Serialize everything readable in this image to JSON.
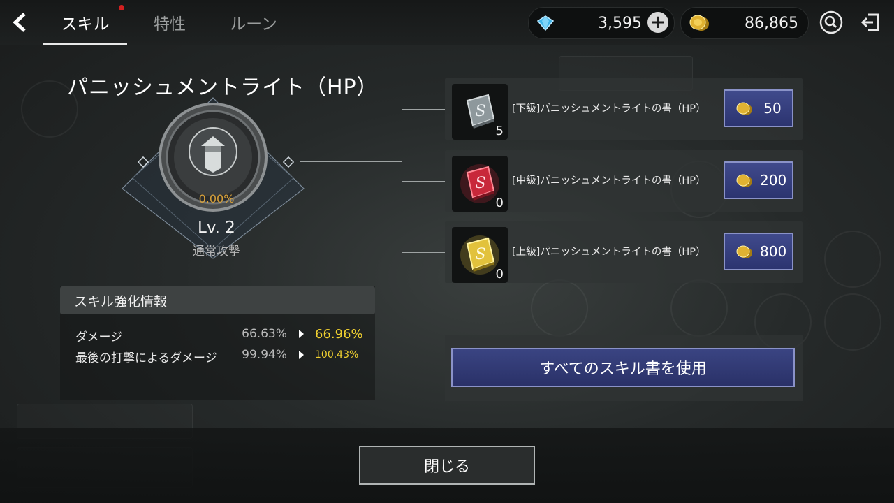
{
  "topbar": {
    "tabs": [
      {
        "label": "スキル",
        "active": true,
        "notify": true
      },
      {
        "label": "特性",
        "active": false,
        "notify": false
      },
      {
        "label": "ルーン",
        "active": false,
        "notify": false
      }
    ],
    "gems": "3,595",
    "gold": "86,865",
    "icons": {
      "back": "back-arrow-icon",
      "search": "search-icon",
      "exit": "exit-icon",
      "gem": "gem-icon",
      "gold": "gold-coin-icon",
      "plus": "plus-icon"
    }
  },
  "skill": {
    "title": "パニッシュメントライト（HP）",
    "progress_text": "0.00%",
    "level": "Lv. 2",
    "type": "通常攻撃"
  },
  "info": {
    "heading": "スキル強化情報",
    "rows": [
      {
        "label": "ダメージ",
        "current": "66.63%",
        "next": "66.96%"
      },
      {
        "label": "最後の打撃によるダメージ",
        "current": "99.94%",
        "next": "100.43%"
      }
    ]
  },
  "books": [
    {
      "name": "[下級]パニッシュメントライトの書（HP）",
      "count": "5",
      "price": "50",
      "color": "#9aa4a8"
    },
    {
      "name": "[中級]パニッシュメントライトの書（HP）",
      "count": "0",
      "price": "200",
      "color": "#d8323c"
    },
    {
      "name": "[上級]パニッシュメントライトの書（HP）",
      "count": "0",
      "price": "800",
      "color": "#e8c840"
    }
  ],
  "use_all_label": "すべてのスキル書を使用",
  "close_label": "閉じる",
  "colors": {
    "accent_button": "#2c3470",
    "highlight_value": "#f0d030",
    "progress": "#d9a23a"
  }
}
